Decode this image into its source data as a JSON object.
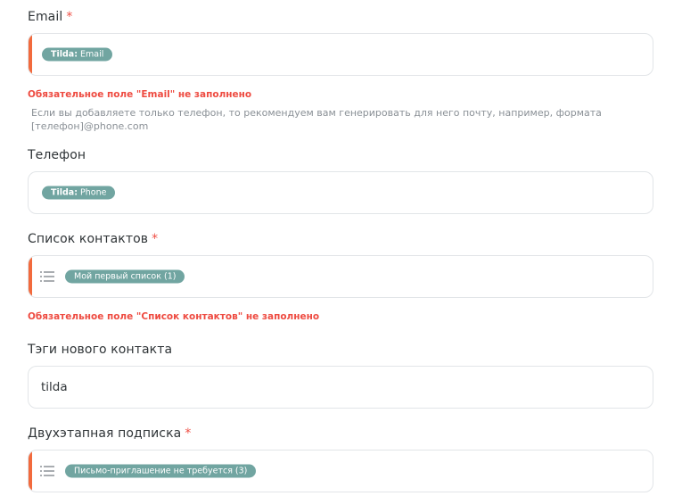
{
  "email": {
    "label": "Email",
    "required_mark": "*",
    "chip_prefix": "Tilda:",
    "chip_value": "Email",
    "error": "Обязательное поле \"Email\" не заполнено",
    "hint": "Если вы добавляете только телефон, то рекомендуем вам генерировать для него почту, например, формата [телефон]@phone.com"
  },
  "phone": {
    "label": "Телефон",
    "chip_prefix": "Tilda:",
    "chip_value": "Phone"
  },
  "contact_list": {
    "label": "Список контактов",
    "required_mark": "*",
    "chip": "Мой первый список (1)",
    "error": "Обязательное поле \"Список контактов\" не заполнено"
  },
  "tags": {
    "label": "Тэги нового контакта",
    "value": "tilda"
  },
  "double_optin": {
    "label": "Двухэтапная подписка",
    "required_mark": "*",
    "chip": "Письмо-приглашение не требуется (3)"
  },
  "colors": {
    "accent_error": "#ef4f45",
    "error_bar": "#f26a3d",
    "chip_bg": "#71a5a1"
  }
}
